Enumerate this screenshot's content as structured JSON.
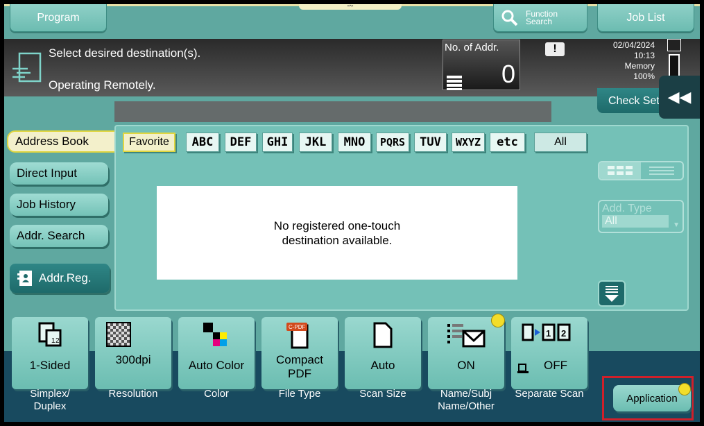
{
  "top": {
    "program": "Program",
    "function_search_1": "Function",
    "function_search_2": "Search",
    "job_list": "Job List"
  },
  "status": {
    "line1": "Select desired destination(s).",
    "line2": "Operating Remotely.",
    "no_addr_label": "No. of Addr.",
    "no_addr_value": "0",
    "date": "02/04/2024",
    "time": "10:13",
    "memory_label": "Memory",
    "memory_value": "100%",
    "check_setting": "Check Set"
  },
  "left_tabs": [
    "Address Book",
    "Direct Input",
    "Job History",
    "Addr. Search"
  ],
  "addr_reg": "Addr.Reg.",
  "index_tabs": {
    "favorite": "Favorite",
    "letters": [
      "ABC",
      "DEF",
      "GHI",
      "JKL",
      "MNO",
      "PQRS",
      "TUV",
      "WXYZ",
      "etc"
    ],
    "all": "All"
  },
  "message": {
    "line1": "No registered one-touch",
    "line2": "destination available."
  },
  "addr_type": {
    "label": "Add. Type",
    "value": "All"
  },
  "settings": [
    {
      "value": "1-Sided",
      "label1": "Simplex/",
      "label2": "Duplex"
    },
    {
      "value": "300dpi",
      "label1": "Resolution",
      "label2": ""
    },
    {
      "value": "Auto Color",
      "label1": "Color",
      "label2": ""
    },
    {
      "value": "Compact PDF",
      "value1": "Compact",
      "value2": "PDF",
      "label1": "File Type",
      "label2": ""
    },
    {
      "value": "Auto",
      "label1": "Scan Size",
      "label2": ""
    },
    {
      "value": "ON",
      "label1": "Name/Subj",
      "label2": "Name/Other"
    },
    {
      "value": "OFF",
      "label1": "Separate Scan",
      "label2": ""
    }
  ],
  "application": "Application",
  "colors": {
    "teal_bg": "#5fa8a0",
    "button": "#8fd0c7",
    "highlight": "#f3f0cb",
    "dark_bar": "#184a5f",
    "red_frame": "#d0202a",
    "yellow_dot": "#f3dd2a"
  }
}
